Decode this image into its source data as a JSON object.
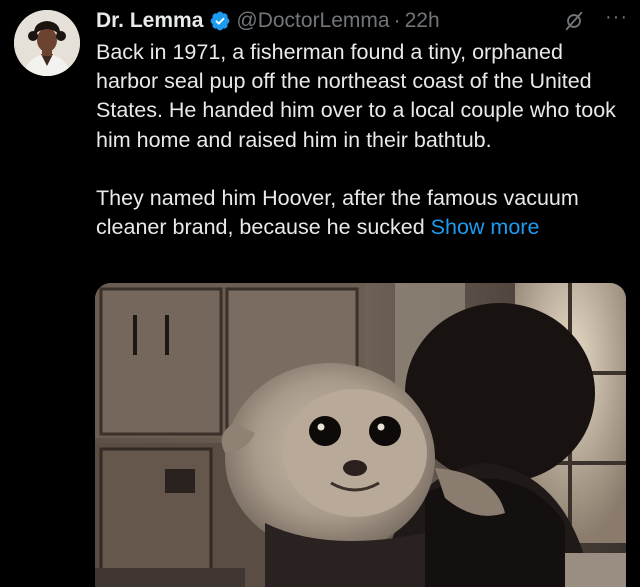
{
  "author": {
    "name": "Dr. Lemma",
    "handle": "@DoctorLemma",
    "separator": "·",
    "time": "22h"
  },
  "icons": {
    "verified": "verified-badge-icon",
    "grok": "grok-icon",
    "more": "more-options-icon"
  },
  "colors": {
    "background": "#000000",
    "text": "#e7e9ea",
    "secondary": "#71767b",
    "link": "#1d9bf0",
    "verified": "#1d9bf0"
  },
  "tweet": {
    "paragraph1": "Back in 1971, a fisherman found a tiny, orphaned harbor seal pup off the northeast coast of the United States. He handed him over to a local couple who took him home and raised him in their bathtub.",
    "paragraph2": "They named him Hoover, after the famous vacuum cleaner brand, because he sucked ",
    "show_more": "Show more"
  },
  "more_glyph": "···"
}
